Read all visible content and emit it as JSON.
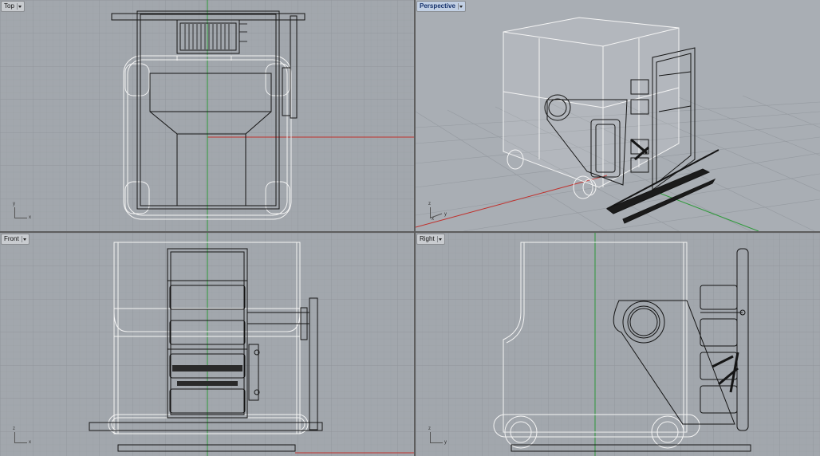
{
  "viewports": {
    "top": {
      "label": "Top",
      "axis_x": "x",
      "axis_y": "y"
    },
    "perspective": {
      "label": "Perspective",
      "axis_x": "x",
      "axis_y": "y",
      "axis_z": "z"
    },
    "front": {
      "label": "Front",
      "axis_x": "x",
      "axis_y": "z"
    },
    "right": {
      "label": "Right",
      "axis_x": "y",
      "axis_y": "z"
    }
  },
  "colors": {
    "viewport_bg": "#a2a7ad",
    "grid_minor": "#989da3",
    "grid_major": "#8d9298",
    "x_axis": "#c0302c",
    "y_axis": "#2e9a3a",
    "wire_dark": "#151515",
    "wire_light": "#f4f4f4",
    "active_tab": "#c2d0e4"
  }
}
